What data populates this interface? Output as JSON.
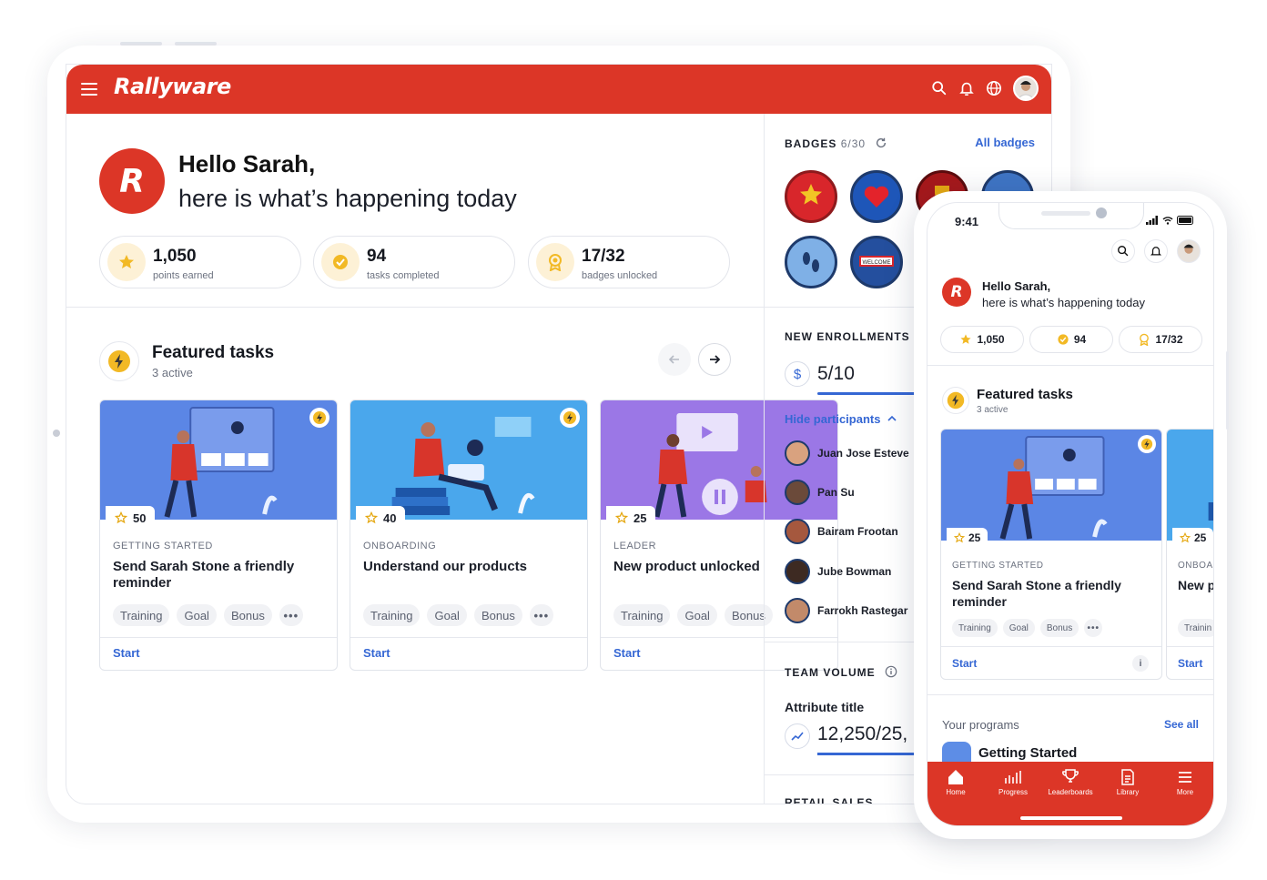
{
  "app": {
    "logo": "Rallyware",
    "logo_mark": "R"
  },
  "header": {
    "icons": [
      "search-icon",
      "bell-icon",
      "globe-icon"
    ]
  },
  "greeting": {
    "hello": "Hello Sarah,",
    "subtitle": "here is what’s happening today"
  },
  "stats": [
    {
      "value": "1,050",
      "label": "points earned",
      "icon": "star-icon"
    },
    {
      "value": "94",
      "label": "tasks completed",
      "icon": "check-icon"
    },
    {
      "value": "17/32",
      "label": "badges unlocked",
      "icon": "award-icon"
    }
  ],
  "featured": {
    "title": "Featured tasks",
    "subtitle": "3 active"
  },
  "tasks": [
    {
      "points": "50",
      "category": "GETTING STARTED",
      "title": "Send Sarah Stone a friendly reminder",
      "tags": [
        "Training",
        "Goal",
        "Bonus"
      ],
      "more": "•••",
      "action": "Start",
      "bg": "#5b86e5"
    },
    {
      "points": "40",
      "category": "ONBOARDING",
      "title": "Understand our products",
      "tags": [
        "Training",
        "Goal",
        "Bonus"
      ],
      "more": "•••",
      "action": "Start",
      "bg": "#4aa7ec"
    },
    {
      "points": "25",
      "category": "LEADER",
      "title": "New product unlocked",
      "tags": [
        "Training",
        "Goal",
        "Bonus"
      ],
      "more": "",
      "action": "Start",
      "bg": "#9b77e6"
    }
  ],
  "badges": {
    "title": "BADGES",
    "count": "6/30",
    "link": "All badges",
    "colors": [
      "#d8262b",
      "#1e56b8",
      "#a6181b",
      "#3f75c5",
      "#7fb0e6",
      "#244f9e"
    ]
  },
  "enrollments": {
    "title": "NEW ENROLLMENTS",
    "value": "5/10",
    "currency_icon": "$",
    "toggle": "Hide participants",
    "participants": [
      "Juan Jose Esteve",
      "Pan Su",
      "Bairam Frootan",
      "Jube Bowman",
      "Farrokh Rastegar"
    ]
  },
  "team_volume": {
    "title": "TEAM VOLUME",
    "attribute": "Attribute title",
    "value": "12,250/25,"
  },
  "retail_sales": {
    "title": "RETAIL SALES"
  },
  "phone": {
    "time": "9:41",
    "hello": "Hello Sarah,",
    "subtitle": "here is what’s happening today",
    "stats": [
      "1,050",
      "94",
      "17/32"
    ],
    "featured_title": "Featured tasks",
    "featured_sub": "3 active",
    "card": {
      "points": "25",
      "category": "GETTING STARTED",
      "title": "Send Sarah Stone a friendly reminder",
      "tags": [
        "Training",
        "Goal",
        "Bonus"
      ],
      "more": "•••",
      "action": "Start",
      "info": "i"
    },
    "card2": {
      "points": "25",
      "category": "ONBOA",
      "title": "New p",
      "tag": "Trainin",
      "action": "Start"
    },
    "programs": {
      "title": "Your programs",
      "link": "See all",
      "first": "Getting Started"
    },
    "tabs": [
      "Home",
      "Progress",
      "Leaderboards",
      "Library",
      "More"
    ]
  },
  "colors": {
    "brand_red": "#dc3627",
    "link_blue": "#3567d4",
    "gold": "#f2b925"
  }
}
